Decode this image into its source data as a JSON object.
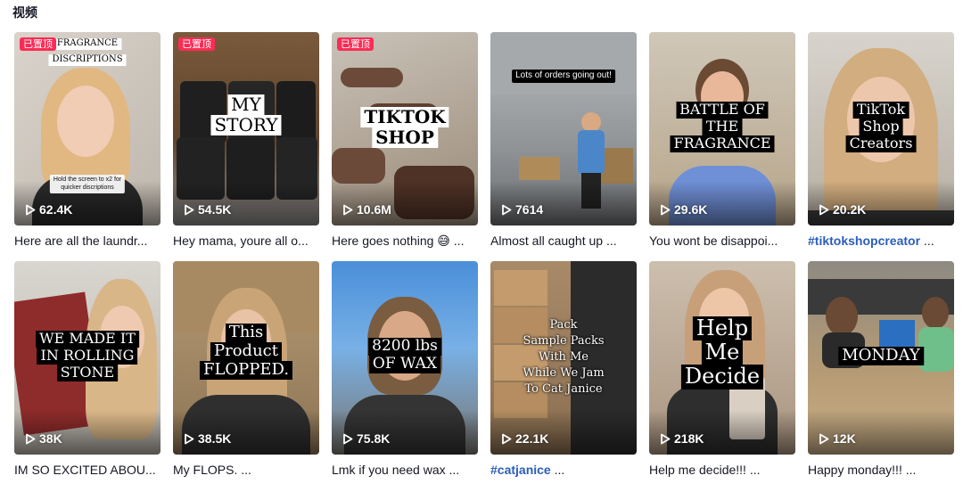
{
  "section": {
    "title": "视频"
  },
  "badge_label": "已置顶",
  "videos": [
    {
      "pinned": true,
      "overlay_lines": [
        "FRAGRANCE",
        "DISCRIPTIONS"
      ],
      "caption_lines": [
        "Hold the screen to x2 for",
        "quicker discriptions"
      ],
      "views": "62.4K",
      "desc_tag": "",
      "desc": "Here are all the laundr..."
    },
    {
      "pinned": true,
      "overlay_lines": [
        "MY",
        "STORY"
      ],
      "caption_lines": [],
      "views": "54.5K",
      "desc_tag": "",
      "desc": "Hey mama, youre all o..."
    },
    {
      "pinned": true,
      "overlay_lines": [
        "TIKTOK",
        "SHOP"
      ],
      "caption_lines": [],
      "views": "10.6M",
      "desc_tag": "",
      "desc": "Here goes nothing 😅 ..."
    },
    {
      "pinned": false,
      "overlay_lines": [
        "Lots of orders going out!"
      ],
      "caption_lines": [],
      "views": "7614",
      "desc_tag": "",
      "desc": "Almost all caught up ..."
    },
    {
      "pinned": false,
      "overlay_lines": [
        "BATTLE OF",
        "THE",
        "FRAGRANCE"
      ],
      "caption_lines": [],
      "views": "29.6K",
      "desc_tag": "",
      "desc": "You wont be disappoi..."
    },
    {
      "pinned": false,
      "overlay_lines": [
        "TikTok",
        "Shop",
        "Creators"
      ],
      "caption_lines": [],
      "views": "20.2K",
      "desc_tag": "#tiktokshopcreator",
      "desc": " ..."
    },
    {
      "pinned": false,
      "overlay_lines": [
        "WE MADE IT",
        "IN ROLLING",
        "STONE"
      ],
      "caption_lines": [],
      "views": "38K",
      "desc_tag": "",
      "desc": "IM SO EXCITED ABOU..."
    },
    {
      "pinned": false,
      "overlay_lines": [
        "This",
        "Product",
        "FLOPPED."
      ],
      "caption_lines": [],
      "views": "38.5K",
      "desc_tag": "",
      "desc": "My FLOPS. ..."
    },
    {
      "pinned": false,
      "overlay_lines": [
        "8200 lbs",
        "OF WAX"
      ],
      "caption_lines": [],
      "views": "75.8K",
      "desc_tag": "",
      "desc": "Lmk if you need wax ..."
    },
    {
      "pinned": false,
      "overlay_lines": [
        "Pack",
        "Sample Packs",
        "With Me",
        "While We Jam",
        "To Cat Janice"
      ],
      "caption_lines": [],
      "views": "22.1K",
      "desc_tag": "#catjanice",
      "desc": " ..."
    },
    {
      "pinned": false,
      "overlay_lines": [
        "Help",
        "Me",
        "Decide"
      ],
      "caption_lines": [],
      "views": "218K",
      "desc_tag": "",
      "desc": "Help me decide!!! ..."
    },
    {
      "pinned": false,
      "overlay_lines": [
        "MONDAY"
      ],
      "caption_lines": [],
      "views": "12K",
      "desc_tag": "",
      "desc": "Happy monday!!! ..."
    }
  ],
  "colors": {
    "badge": "#fe2c55",
    "hashtag": "#2b5db9",
    "text": "#161823"
  },
  "icons": {
    "play": "play-icon"
  }
}
